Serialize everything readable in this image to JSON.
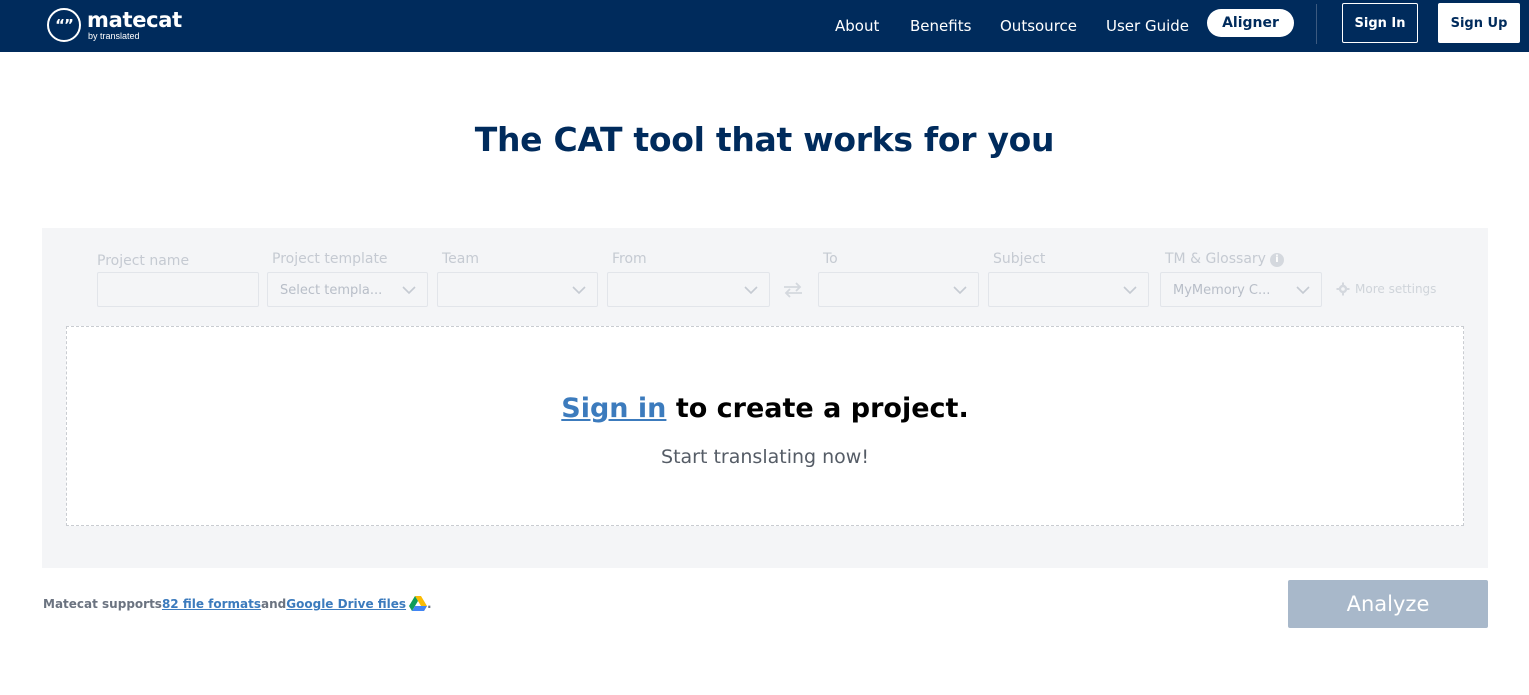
{
  "header": {
    "logo_name": "matecat",
    "logo_sub": "by translated",
    "logo_glyph": "“”",
    "nav": {
      "about": "About",
      "benefits": "Benefits",
      "outsource": "Outsource",
      "user_guide": "User Guide",
      "aligner": "Aligner"
    },
    "sign_in": "Sign In",
    "sign_up": "Sign Up"
  },
  "headline": "The CAT tool that works for you",
  "form": {
    "project_name": {
      "label": "Project name",
      "value": ""
    },
    "project_template": {
      "label": "Project template",
      "value": "Select templa..."
    },
    "team": {
      "label": "Team",
      "value": ""
    },
    "from": {
      "label": "From",
      "value": ""
    },
    "to": {
      "label": "To",
      "value": ""
    },
    "subject": {
      "label": "Subject",
      "value": ""
    },
    "tm_glossary": {
      "label": "TM & Glossary",
      "value": "MyMemory C..."
    },
    "more_settings": "More settings"
  },
  "drop_area": {
    "sign_in_link": "Sign in",
    "main_rest": " to create a project.",
    "sub": "Start translating now!"
  },
  "footer": {
    "supports_prefix": "Matecat supports ",
    "formats_link": "82 file formats ",
    "and": "and ",
    "gdrive_link": "Google Drive files",
    "period": "."
  },
  "analyze_label": "Analyze",
  "colors": {
    "brand_navy": "#002b5c",
    "link_blue": "#3c7bbd",
    "analyze_disabled": "#a8b8ca"
  }
}
